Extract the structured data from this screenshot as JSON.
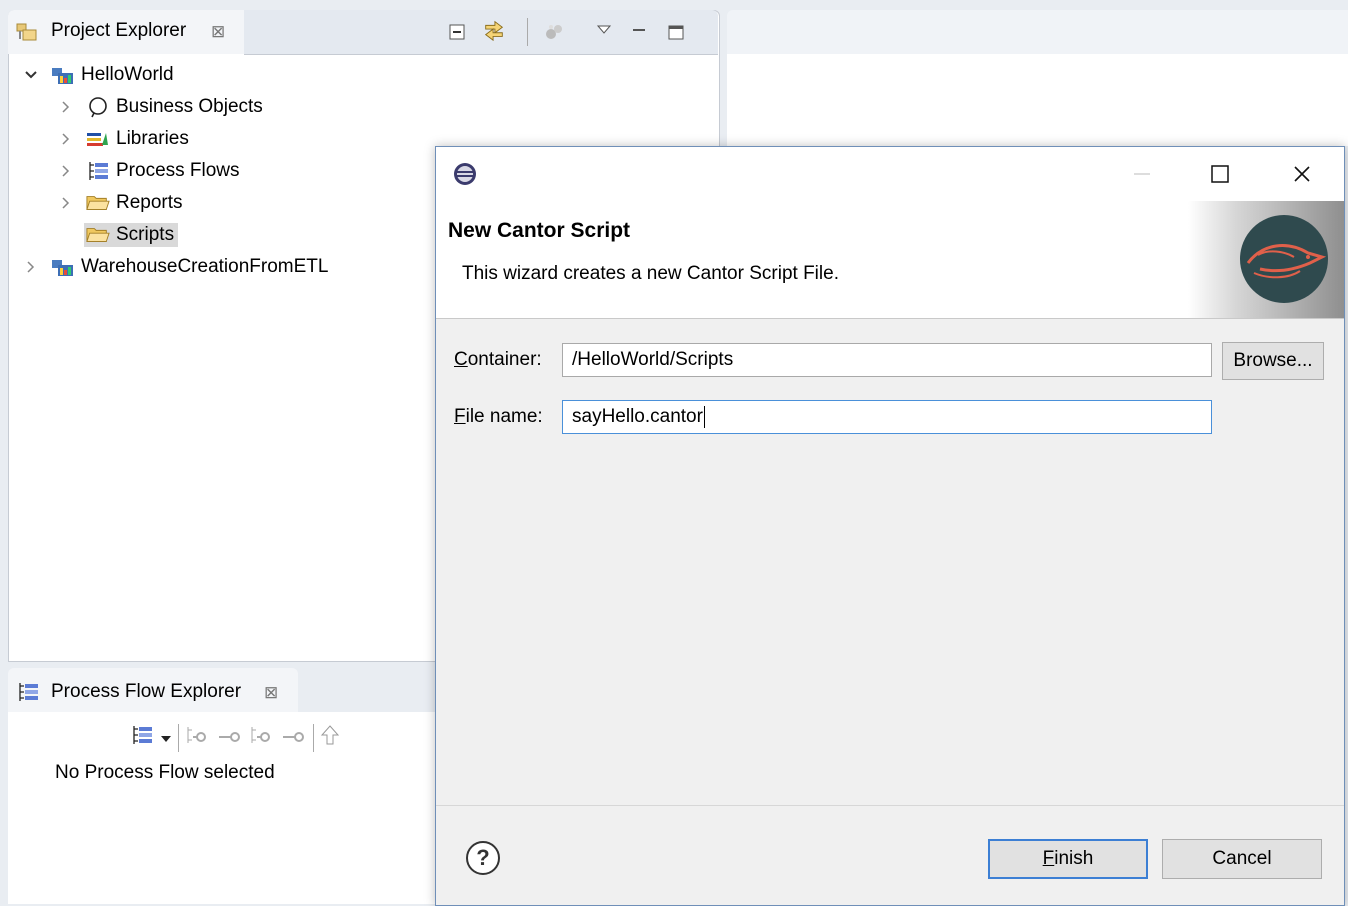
{
  "project_explorer": {
    "tab_title": "Project Explorer",
    "close_glyph": "⊠",
    "toolbar": [
      "collapse-all-icon",
      "link-with-editor-icon",
      "filter-icon",
      "view-menu-icon",
      "minimize-icon",
      "maximize-icon"
    ],
    "tree": [
      {
        "label": "HelloWorld",
        "expanded": true,
        "icon": "project-icon",
        "level": 0
      },
      {
        "label": "Business Objects",
        "icon": "business-objects-icon",
        "level": 1
      },
      {
        "label": "Libraries",
        "icon": "libraries-icon",
        "level": 1
      },
      {
        "label": "Process Flows",
        "icon": "process-flows-icon",
        "level": 1
      },
      {
        "label": "Reports",
        "icon": "folder-icon",
        "level": 1
      },
      {
        "label": "Scripts",
        "icon": "folder-icon",
        "level": 1,
        "selected": true
      },
      {
        "label": "WarehouseCreationFromETL",
        "icon": "project-icon",
        "level": 0
      }
    ]
  },
  "process_flow_explorer": {
    "tab_title": "Process Flow Explorer",
    "close_glyph": "⊠",
    "status_text": "No Process Flow selected"
  },
  "dialog": {
    "title": "New Cantor Script",
    "description": "This wizard creates a new Cantor Script File.",
    "container_label_u": "C",
    "container_label_rest": "ontainer:",
    "container_value": "/HelloWorld/Scripts",
    "browse_label": "Browse...",
    "file_label_u": "F",
    "file_label_rest": "ile name:",
    "file_value": "sayHello.cantor",
    "finish_u": "F",
    "finish_rest": "inish",
    "cancel_label": "Cancel",
    "help_glyph": "?",
    "colors": {
      "accent": "#3c7fd4",
      "banner_circle": "#2f4a4e",
      "logo_stroke": "#e0604a"
    }
  }
}
